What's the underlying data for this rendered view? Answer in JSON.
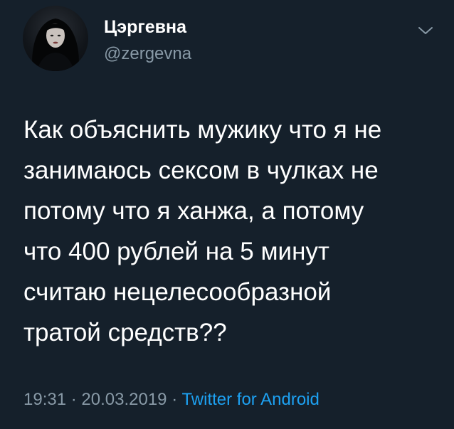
{
  "author": {
    "display_name": "Цэргевна",
    "handle": "@zergevna"
  },
  "tweet": {
    "text": "Как объяснить мужику что я не\nзанимаюсь сексом в чулках не\nпотому что я ханжа, а потому\nчто 400 рублей на 5 минут\nсчитаю нецелесообразной\nтратой средств??"
  },
  "meta": {
    "time": "19:31",
    "separator": "·",
    "date": "20.03.2019",
    "source": "Twitter for Android"
  },
  "icons": {
    "caret": "chevron-down-icon"
  },
  "colors": {
    "background": "#15202b",
    "primary_text": "#ffffff",
    "secondary_text": "#8899a6",
    "link": "#1da1f2"
  }
}
